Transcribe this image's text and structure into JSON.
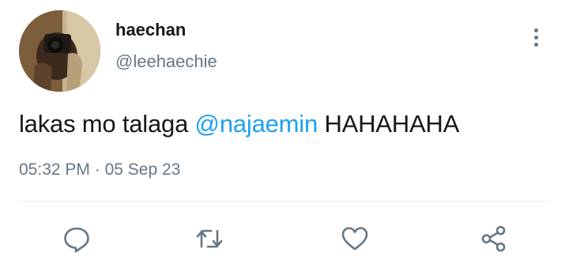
{
  "tweet": {
    "display_name": "haechan",
    "username": "@leehaechie",
    "text_prefix": "lakas mo talaga ",
    "mention": "@najaemin",
    "text_suffix": " HAHAHAHA",
    "time": "05:32 PM",
    "separator": "·",
    "date": "05 Sep 23"
  },
  "icons": {
    "more": "more-vertical-icon",
    "reply": "reply-icon",
    "retweet": "retweet-icon",
    "like": "heart-icon",
    "share": "share-icon"
  },
  "colors": {
    "text": "#14171a",
    "secondary": "#657786",
    "mention": "#1da1f2",
    "divider": "#e6ecf0"
  }
}
